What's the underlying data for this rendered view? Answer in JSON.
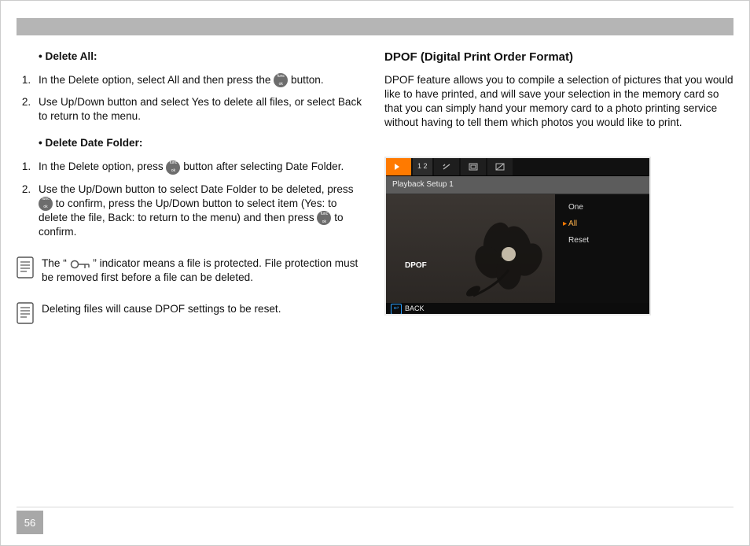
{
  "page_number": "56",
  "left": {
    "section1_title": "• Delete All:",
    "section1_items": {
      "0": {
        "pre": "In the Delete option, select All and then press the ",
        "post": " button."
      },
      "1": "Use Up/Down button and select Yes to delete all files, or select Back to return to the menu."
    },
    "section2_title": "• Delete Date Folder:",
    "section2_items": {
      "0": {
        "pre": "In the Delete option, press ",
        "post": " button after selecting Date Folder."
      },
      "1": {
        "a": "Use the Up/Down button to select Date Folder to be deleted, press ",
        "b": " to confirm, press the Up/Down button to select item (Yes: to delete the file, Back: to return to the menu) and then press ",
        "c": " to confirm."
      }
    },
    "note1": {
      "pre": "The “",
      "post": "” indicator means a file is protected. File protection must be removed first before a file can be deleted."
    },
    "note2": "Deleting files will cause DPOF settings to be reset."
  },
  "right": {
    "heading": "DPOF (Digital Print Order Format)",
    "paragraph": "DPOF feature allows you to compile a selection of pictures that you would like to have printed, and will save your selection in the memory card so that you can simply hand your memory card to a photo printing service without having to tell them which photos you would like to print."
  },
  "screenshot": {
    "tabs": {
      "play": "▶",
      "numbers": "1  2",
      "tool": "⚒",
      "card": "▣",
      "adj": "☐"
    },
    "header": "Playback Setup 1",
    "left_label": "DPOF",
    "menu": {
      "one": "One",
      "all": "All",
      "reset": "Reset"
    },
    "footer": "BACK"
  },
  "icons": {
    "func_top": "func",
    "func_bot": "ok"
  }
}
